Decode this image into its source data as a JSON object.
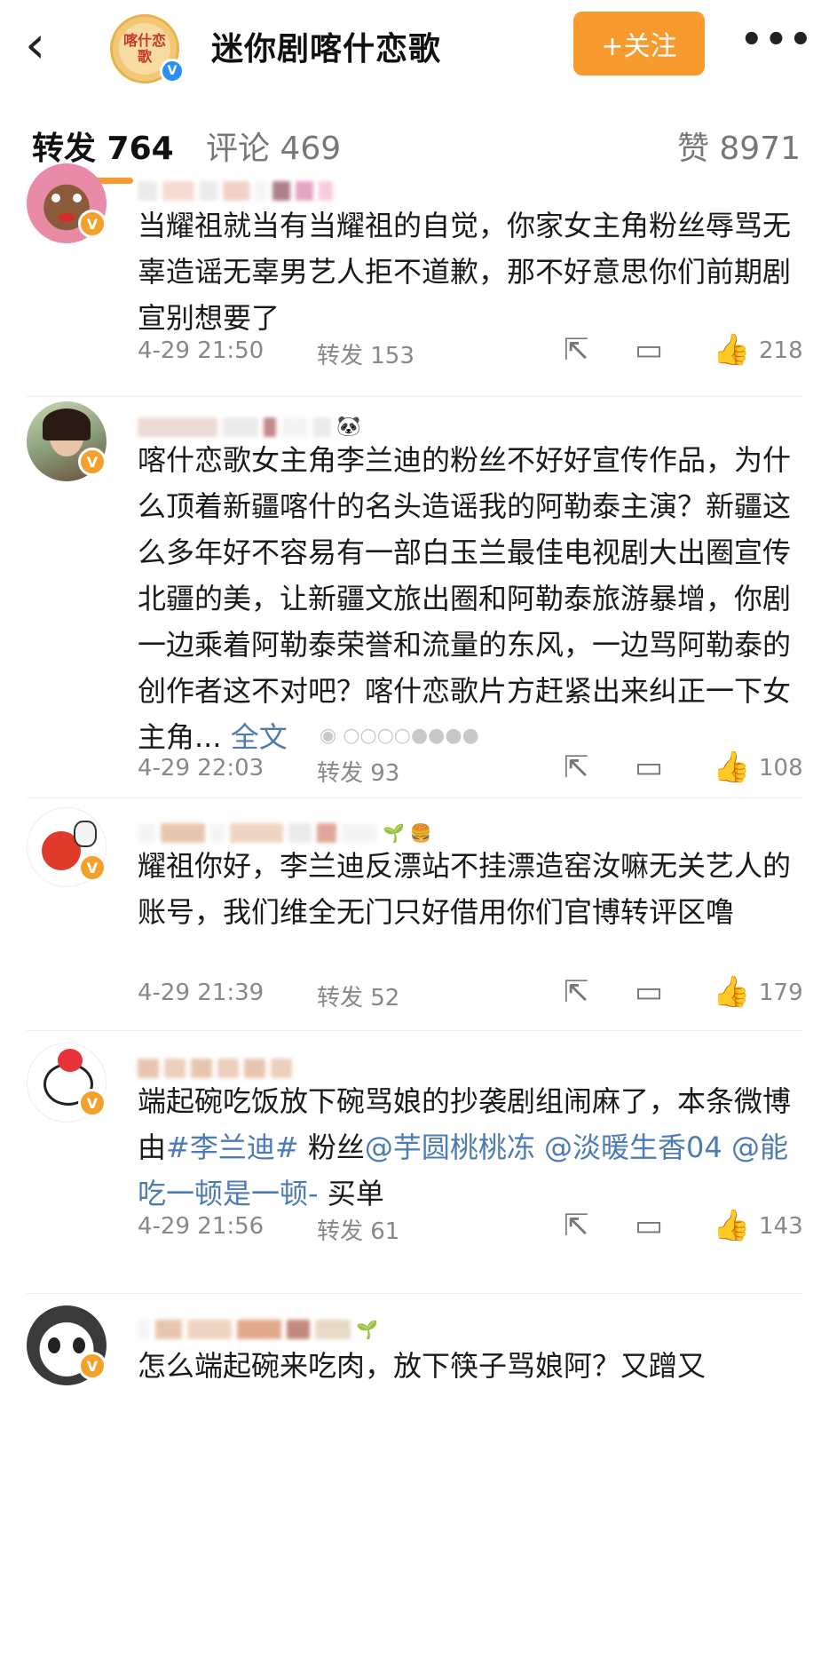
{
  "header": {
    "back_icon": "chevron-left-icon",
    "logo_text": "喀什恋歌",
    "account_name": "迷你剧喀什恋歌",
    "follow_label": "+关注",
    "more_label": "•••"
  },
  "tabs": {
    "repost": "转发 764",
    "comment": "评论 469",
    "like": "赞 8971"
  },
  "colors": {
    "accent": "#f79b2f",
    "verified_badge": "#f2a12b",
    "link": "#4d7bb3"
  },
  "posts": [
    {
      "text": "当耀祖就当有当耀祖的自觉，你家女主角粉丝辱骂无辜造谣无辜男艺人拒不道歉，那不好意思你们前期剧宣别想要了",
      "time": "4-29 21:50",
      "repost": "转发 153",
      "likes": "218"
    },
    {
      "text": "喀什恋歌女主角李兰迪的粉丝不好好宣传作品，为什么顶着新疆喀什的名头造谣我的阿勒泰主演？新疆这么多年好不容易有一部白玉兰最佳电视剧大出圈宣传北疆的美，让新疆文旅出圈和阿勒泰旅游暴增，你剧一边乘着阿勒泰荣誉和流量的东风，一边骂阿勒泰的创作者这不对吧？喀什恋歌片方赶紧出来纠正一下女主角...",
      "full_text_label": "全文",
      "time": "4-29 22:03",
      "repost": "转发 93",
      "likes": "108"
    },
    {
      "text": "耀祖你好，李兰迪反漂站不挂漂造窑汝嘛无关艺人的账号，我们维全无门只好借用你们官博转评区噜",
      "time": "4-29 21:39",
      "repost": "转发 52",
      "likes": "179"
    },
    {
      "text_plain_1": "端起碗吃饭放下碗骂娘的抄袭剧组闹麻了，本条微博由",
      "tag": "#李兰迪#",
      "text_plain_2": " 粉丝",
      "mention_1": "@芋圆桃桃冻",
      "text_plain_3": " ",
      "mention_2": "@淡暖生香04",
      "text_plain_4": " ",
      "mention_3": "@能吃一顿是一顿-",
      "text_plain_5": " 买单",
      "time": "4-29 21:56",
      "repost": "转发 61",
      "likes": "143"
    },
    {
      "text": "怎么端起碗来吃肉，放下筷子骂娘阿？又蹭又"
    }
  ],
  "icons": {
    "share": "share-icon",
    "comment": "comment-icon",
    "like": "thumbs-up-icon",
    "verified": "verified-v-icon"
  }
}
